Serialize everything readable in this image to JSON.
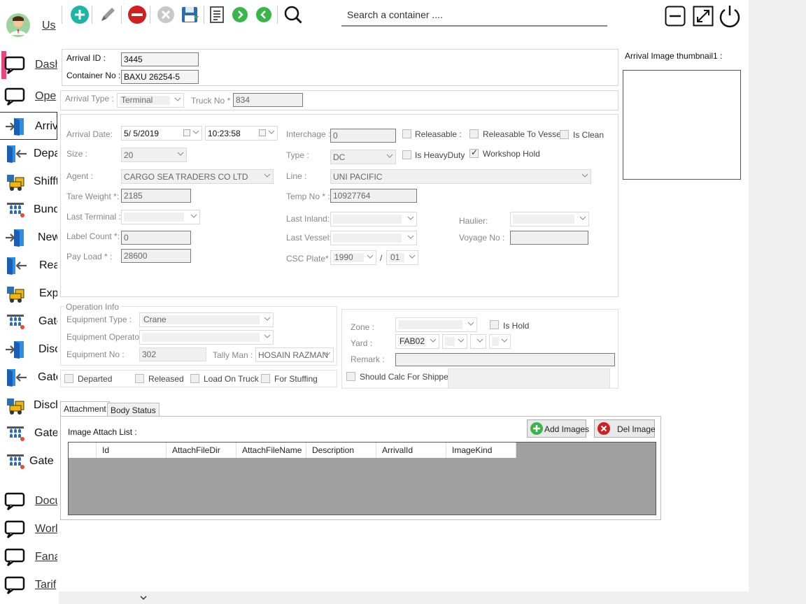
{
  "sidebar": {
    "user_label": "Us",
    "items": [
      {
        "label": "Dash",
        "link": true
      },
      {
        "label": "Ope",
        "link": true
      },
      {
        "label": "Arriva",
        "link": false
      },
      {
        "label": "Depa",
        "link": false
      },
      {
        "label": "Shifft",
        "link": false
      },
      {
        "label": "Bund",
        "link": false
      },
      {
        "label": "New",
        "link": false
      },
      {
        "label": "Rea",
        "link": false
      },
      {
        "label": "Exp",
        "link": false
      },
      {
        "label": "Gate",
        "link": false
      },
      {
        "label": "Disc",
        "link": false
      },
      {
        "label": "Gate",
        "link": false
      },
      {
        "label": "Disch",
        "link": false
      },
      {
        "label": "Gate",
        "link": false
      },
      {
        "label": "Gate C",
        "link": false
      },
      {
        "label": "Docu",
        "link": true
      },
      {
        "label": "Worl",
        "link": true
      },
      {
        "label": "Fana",
        "link": true
      },
      {
        "label": "Tarif",
        "link": true
      }
    ]
  },
  "toolbar": {
    "search_placeholder": "Search a container ....",
    "icons": [
      "add-icon",
      "edit-icon",
      "delete-icon",
      "cancel-icon",
      "save-icon",
      "report-icon",
      "next-icon",
      "previous-icon",
      "search-icon"
    ]
  },
  "window_controls": [
    "minimize-icon",
    "fullscreen-icon",
    "power-icon"
  ],
  "header_panel": {
    "arrival_id_label": "Arrival ID :",
    "arrival_id": "3445",
    "container_no_label": "Container No :",
    "container_no": "BAXU 26254-5"
  },
  "type_row": {
    "arrival_type_label": "Arrival Type :",
    "arrival_type": "Terminal",
    "truck_no_label": "Truck No * :",
    "truck_no": "834"
  },
  "details": {
    "arrival_date_label": "Arrival Date:",
    "arrival_date": "5/  5/2019",
    "arrival_time": "10:23:58",
    "interchange_label": "Interchage :",
    "interchange": "0",
    "releasable_label": "Releasable :",
    "releasable_to_vessel_label": "Releasable To Vessel",
    "is_clean_label": "Is Clean",
    "size_label": "Size :",
    "size": "20",
    "type_label": "Type :",
    "type": "DC",
    "is_heavy_duty_label": "Is HeavyDuty",
    "workshop_hold_label": "Workshop Hold",
    "workshop_hold_checked": true,
    "agent_label": "Agent :",
    "agent": "CARGO SEA TRADERS CO LTD",
    "line_label": "Line :",
    "line": "UNI PACIFIC",
    "tare_weight_label": "Tare Weight *:",
    "tare_weight": "2185",
    "temp_no_label": "Temp No * :",
    "temp_no": "10927764",
    "last_terminal_label": "Last Terminal :",
    "last_inland_label": "Last Inland:",
    "haulier_label": "Haulier:",
    "label_count_label": "Label Count *:",
    "label_count": "0",
    "last_vessel_label": "Last Vessel:",
    "voyage_no_label": "Voyage No :",
    "pay_load_label": "Pay Load * :",
    "pay_load": "28600",
    "csc_plate_label": "CSC Plate* :",
    "csc_plate_year": "1990",
    "csc_plate_sep": "/",
    "csc_plate_month": "01"
  },
  "operation": {
    "legend": "Operation Info",
    "equipment_type_label": "Equipment Type :",
    "equipment_type": "Crane",
    "equipment_operator_label": "Equipment Operator :",
    "equipment_no_label": "Equipment No :",
    "equipment_no": "302",
    "tally_man_label": "Tally Man :",
    "tally_man": "HOSAIN RAZMAN",
    "departed_label": "Departed",
    "released_label": "Released",
    "load_on_truck_label": "Load On Truck",
    "for_stuffing_label": "For Stuffing"
  },
  "zone_panel": {
    "zone_label": "Zone :",
    "is_hold_label": "Is Hold",
    "yard_label": "Yard :",
    "yard": "FAB02",
    "remark_label": "Remark :",
    "should_calc_label": "Should Calc For Shipper"
  },
  "thumbnail": {
    "label": "Arrival Image thumbnail1 :"
  },
  "tabs": [
    {
      "label": "Attachment",
      "active": true
    },
    {
      "label": "Body Status",
      "active": false
    }
  ],
  "attachment": {
    "list_label": "Image Attach List :",
    "add_images_label": "Add Images",
    "del_image_label": "Del Image",
    "columns": [
      "Id",
      "AttachFileDir",
      "AttachFileName",
      "Description",
      "ArrivalId",
      "ImageKind"
    ]
  },
  "colors": {
    "sidebar_active_accent": "#e8467c",
    "grid_background": "#a0a0a0",
    "toolbar_add": "#1fb5a6",
    "toolbar_delete": "#d11e1e"
  }
}
